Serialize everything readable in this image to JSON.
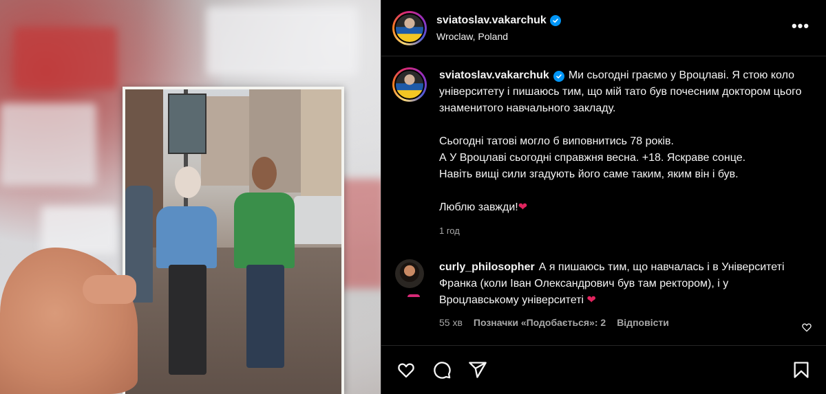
{
  "post": {
    "author": {
      "username": "sviatoslav.vakarchuk",
      "verified": true,
      "location": "Wroclaw, Poland"
    },
    "caption": {
      "username": "sviatoslav.vakarchuk",
      "paragraph_1": "Ми сьогодні граємо у Вроцлаві. Я стою коло університету і пишаюсь тим, що мій тато був почесним доктором цього знаменитого навчального закладу.",
      "paragraph_2_line_1": "Сьогодні татові могло б виповнитись 78 років.",
      "paragraph_2_line_2": "А У Вроцлаві сьогодні справжня весна. +18. Яскраве сонце.",
      "paragraph_2_line_3": "Навіть вищі сили згадують його саме таким, яким він і був.",
      "paragraph_3": "Люблю завжди!",
      "paragraph_3_emoji": "❤",
      "time": "1 год"
    },
    "comments": [
      {
        "username": "curly_philosopher",
        "text": "А я пишаюсь тим, що навчалась і в Університеті Франка (коли Іван Олександрович був там ректором), і у Вроцлавському університеті",
        "emoji": "❤",
        "time": "55 хв",
        "likes_label": "Позначки «Подобається»: 2",
        "reply_label": "Відповісти"
      }
    ]
  },
  "icons": {
    "more": "more-horizontal-icon",
    "like": "heart-icon",
    "comment": "comment-icon",
    "share": "share-icon",
    "save": "bookmark-icon"
  },
  "colors": {
    "background": "#000000",
    "text": "#f5f5f5",
    "secondary_text": "#a8a8a8",
    "verified": "#0095f6",
    "heart": "#e0245e",
    "divider": "#262626"
  }
}
